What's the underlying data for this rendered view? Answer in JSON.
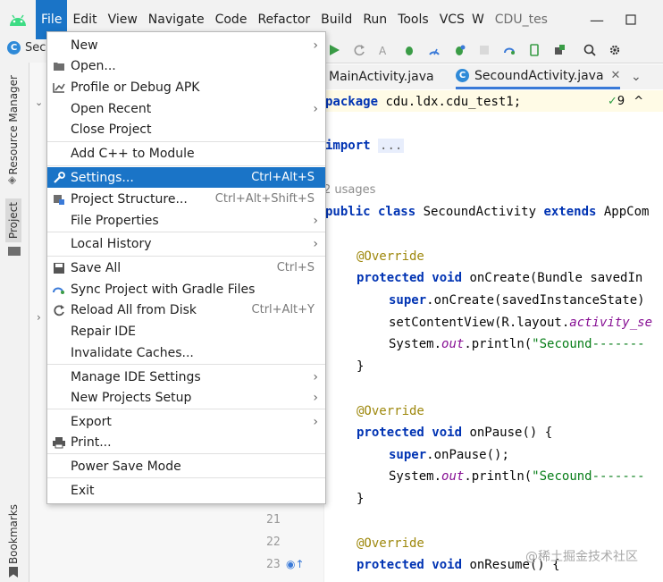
{
  "menubar": {
    "items": [
      "File",
      "Edit",
      "View",
      "Navigate",
      "Code",
      "Refactor",
      "Build",
      "Run",
      "Tools",
      "VCS",
      "W"
    ],
    "project_title": "CDU_tes",
    "accent": "#1a74c7"
  },
  "toolbar": {
    "left_label": "Sec"
  },
  "left_strip": {
    "resource_manager": "Resource Manager",
    "project": "Project",
    "bookmarks": "Bookmarks"
  },
  "tabs": [
    {
      "label": "MainActivity.java"
    },
    {
      "label": "SecoundActivity.java"
    }
  ],
  "editor": {
    "inspection_count": "9",
    "usages": "2 usages",
    "lines": {
      "package": "package cdu.ldx.cdu_test1;",
      "import_kw": "import",
      "import_fold": "...",
      "class_prefix": "public class ",
      "class_name": "SecoundActivity ",
      "class_extends": "extends",
      "class_super": " AppCom",
      "override": "@Override",
      "on_create_sig": "onCreate(Bundle savedIn",
      "super_create": ".onCreate(savedInstanceState)",
      "set_content": "setContentView(R.layout.",
      "set_content_it": "activity_se",
      "sysout_prefix": "System.",
      "sysout_out": "out",
      "sysout_println": ".println(",
      "str_secound": "\"Secound-------",
      "close_brace": "}",
      "on_pause_sig": "onPause() {",
      "super_pause": ".onPause();",
      "on_resume_sig": "onResume() {",
      "kw_protected": "protected",
      "kw_void": "void",
      "kw_super": "super"
    },
    "line_numbers": [
      "21",
      "22",
      "23"
    ]
  },
  "file_menu": {
    "items": [
      {
        "label": "New",
        "shortcut": "",
        "arrow": true
      },
      {
        "label": "Open...",
        "shortcut": "",
        "arrow": false
      },
      {
        "label": "Profile or Debug APK",
        "shortcut": "",
        "arrow": false
      },
      {
        "label": "Open Recent",
        "shortcut": "",
        "arrow": true
      },
      {
        "label": "Close Project",
        "shortcut": "",
        "arrow": false
      },
      {
        "label": "Add C++ to Module",
        "shortcut": "",
        "arrow": false
      },
      {
        "label": "Settings...",
        "shortcut": "Ctrl+Alt+S",
        "arrow": false
      },
      {
        "label": "Project Structure...",
        "shortcut": "Ctrl+Alt+Shift+S",
        "arrow": false
      },
      {
        "label": "File Properties",
        "shortcut": "",
        "arrow": true
      },
      {
        "label": "Local History",
        "shortcut": "",
        "arrow": true
      },
      {
        "label": "Save All",
        "shortcut": "Ctrl+S",
        "arrow": false
      },
      {
        "label": "Sync Project with Gradle Files",
        "shortcut": "",
        "arrow": false
      },
      {
        "label": "Reload All from Disk",
        "shortcut": "Ctrl+Alt+Y",
        "arrow": false
      },
      {
        "label": "Repair IDE",
        "shortcut": "",
        "arrow": false
      },
      {
        "label": "Invalidate Caches...",
        "shortcut": "",
        "arrow": false
      },
      {
        "label": "Manage IDE Settings",
        "shortcut": "",
        "arrow": true
      },
      {
        "label": "New Projects Setup",
        "shortcut": "",
        "arrow": true
      },
      {
        "label": "Export",
        "shortcut": "",
        "arrow": true
      },
      {
        "label": "Print...",
        "shortcut": "",
        "arrow": false
      },
      {
        "label": "Power Save Mode",
        "shortcut": "",
        "arrow": false
      },
      {
        "label": "Exit",
        "shortcut": "",
        "arrow": false
      }
    ],
    "highlighted": "Settings..."
  },
  "watermark": "@稀土掘金技术社区"
}
